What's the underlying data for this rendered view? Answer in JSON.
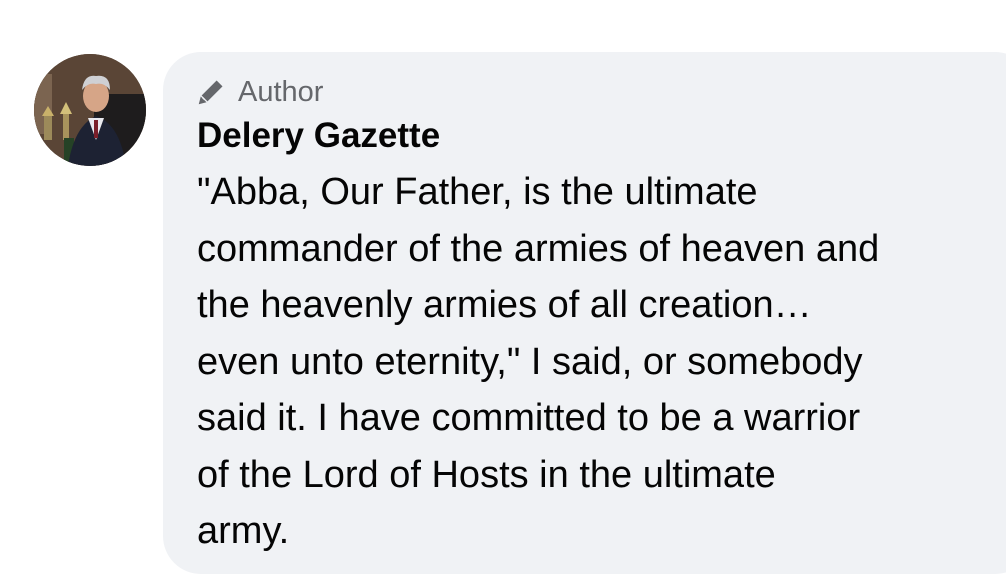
{
  "comment": {
    "badge": {
      "icon": "pencil-icon",
      "label": "Author"
    },
    "author_name": "Delery Gazette",
    "text": "\"Abba, Our Father, is the ultimate\ncommander of the armies of heaven and\nthe heavenly armies of all creation…\neven unto eternity,\" I said, or somebody\nsaid it. I have committed to be a warrior\nof the Lord of Hosts in the ultimate\narmy."
  },
  "colors": {
    "bubble_background": "#f0f2f5",
    "badge_text": "#65676b",
    "primary_text": "#050505"
  }
}
